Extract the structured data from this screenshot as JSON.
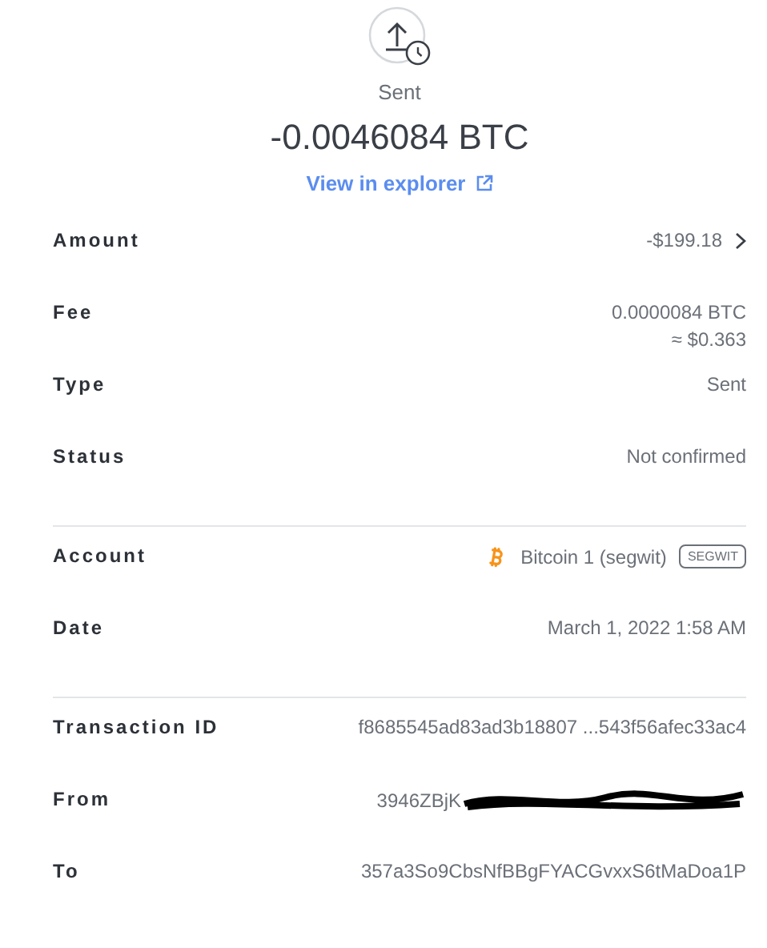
{
  "header": {
    "status": "Sent",
    "amount": "-0.0046084 BTC",
    "explorer_link": "View in explorer"
  },
  "sections": [
    {
      "rows": [
        {
          "kind": "text",
          "label": "Amount",
          "value": "-$199.18",
          "chevron": true
        },
        {
          "kind": "text",
          "label": "Fee",
          "value": "0.0000084 BTC",
          "subvalue": "≈ $0.363"
        },
        {
          "kind": "text",
          "label": "Type",
          "value": "Sent"
        },
        {
          "kind": "text",
          "label": "Status",
          "value": "Not confirmed"
        }
      ]
    },
    {
      "rows": [
        {
          "kind": "account",
          "label": "Account",
          "value": "Bitcoin 1 (segwit)",
          "tag": "SEGWIT"
        },
        {
          "kind": "text",
          "label": "Date",
          "value": "March 1, 2022 1:58 AM"
        }
      ]
    },
    {
      "rows": [
        {
          "kind": "text",
          "label": "Transaction ID",
          "value": "f8685545ad83ad3b18807 ...543f56afec33ac4"
        },
        {
          "kind": "redacted",
          "label": "From",
          "value": "3946ZBjK"
        },
        {
          "kind": "text",
          "label": "To",
          "value": "357a3So9CbsNfBBgFYACGvxxS6tMaDoa1P"
        }
      ]
    }
  ]
}
